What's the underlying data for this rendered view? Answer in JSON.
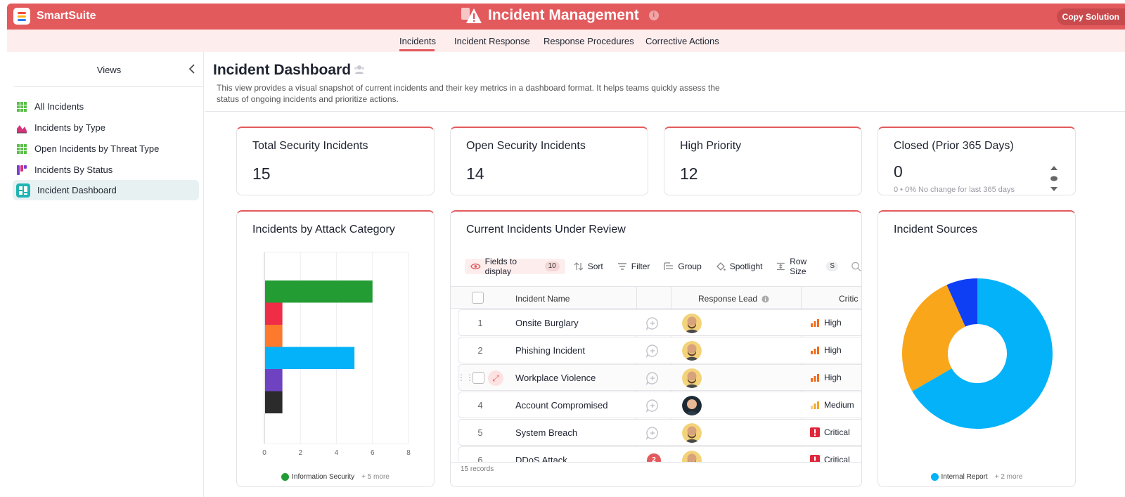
{
  "header": {
    "brand": "SmartSuite",
    "app_title": "Incident Management",
    "info": "i",
    "copy_label": "Copy Solution",
    "accent": "#e35a5d"
  },
  "tabs": [
    {
      "label": "Incidents",
      "active": true
    },
    {
      "label": "Incident Response",
      "active": false
    },
    {
      "label": "Response Procedures",
      "active": false
    },
    {
      "label": "Corrective Actions",
      "active": false
    }
  ],
  "sidebar": {
    "title": "Views",
    "items": [
      {
        "label": "All Incidents",
        "icon": "grid-view-icon"
      },
      {
        "label": "Incidents by Type",
        "icon": "chart-view-icon"
      },
      {
        "label": "Open Incidents by Threat Type",
        "icon": "grid-view-icon"
      },
      {
        "label": "Incidents By Status",
        "icon": "kanban-view-icon"
      },
      {
        "label": "Incident Dashboard",
        "icon": "dashboard-view-icon",
        "active": true
      }
    ]
  },
  "dashboard": {
    "title": "Incident Dashboard",
    "description": "This view provides a visual snapshot of current incidents and their key metrics in a dashboard format. It helps teams quickly assess the status of ongoing incidents and prioritize actions."
  },
  "metrics": [
    {
      "title": "Total Security Incidents",
      "value": "15"
    },
    {
      "title": "Open Security Incidents",
      "value": "14"
    },
    {
      "title": "High Priority",
      "value": "12"
    },
    {
      "title": "Closed (Prior 365 Days)",
      "value": "0",
      "sub": "0 • 0% No change for last 365 days"
    }
  ],
  "attack_chart": {
    "title": "Incidents by Attack Category",
    "legend_label": "Information Security",
    "legend_more": "+ 5 more"
  },
  "chart_data": [
    {
      "type": "bar",
      "orientation": "horizontal",
      "values": [
        6,
        1,
        1,
        5,
        1,
        1
      ],
      "colors": [
        "#229c33",
        "#ef2d47",
        "#fd7a2d",
        "#03b2f8",
        "#6f42c1",
        "#2b2b2b"
      ],
      "xlim": [
        0,
        8
      ],
      "xticks": [
        "0",
        "2",
        "4",
        "6",
        "8"
      ],
      "grid": true
    },
    {
      "type": "pie",
      "donut": true,
      "values": [
        10,
        4,
        1
      ],
      "colors": [
        "#03b2f8",
        "#faa61a",
        "#0f3ff5"
      ]
    }
  ],
  "sources_chart": {
    "title": "Incident Sources",
    "legend_label": "Internal Report",
    "legend_more": "+ 2 more"
  },
  "review": {
    "title": "Current Incidents Under Review",
    "toolbar": {
      "fields": "Fields to display",
      "fields_count": "10",
      "sort": "Sort",
      "filter": "Filter",
      "group": "Group",
      "spotlight": "Spotlight",
      "row_size": "Row Size",
      "row_size_value": "S"
    },
    "columns": {
      "name": "Incident Name",
      "lead": "Response Lead",
      "criticality": "Critic"
    },
    "rows": [
      {
        "num": "1",
        "name": "Onsite Burglary",
        "criticality": "High",
        "level": "high",
        "avatar": "bearded"
      },
      {
        "num": "2",
        "name": "Phishing Incident",
        "criticality": "High",
        "level": "high",
        "avatar": "bearded"
      },
      {
        "num": "",
        "name": "Workplace Violence",
        "criticality": "High",
        "level": "high",
        "avatar": "bearded",
        "hover": true
      },
      {
        "num": "4",
        "name": "Account Compromised",
        "criticality": "Medium",
        "level": "medium",
        "avatar": "smiling"
      },
      {
        "num": "5",
        "name": "System Breach",
        "criticality": "Critical",
        "level": "critical",
        "avatar": "bearded"
      },
      {
        "num": "6",
        "name": "DDoS Attack",
        "criticality": "Critical",
        "level": "critical",
        "avatar": "bearded",
        "comments": "2"
      }
    ],
    "footer": "15 records"
  }
}
